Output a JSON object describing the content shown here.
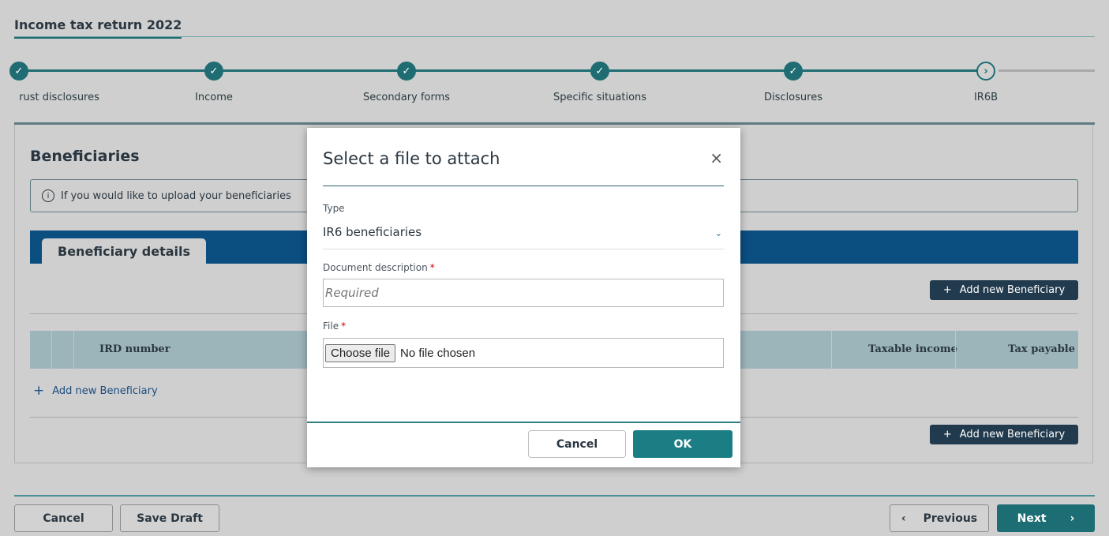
{
  "page": {
    "title": "Income tax return 2022"
  },
  "stepper": {
    "steps": [
      {
        "label": "rust disclosures",
        "status": "complete"
      },
      {
        "label": "Income",
        "status": "complete"
      },
      {
        "label": "Secondary forms",
        "status": "complete"
      },
      {
        "label": "Specific situations",
        "status": "complete"
      },
      {
        "label": "Disclosures",
        "status": "complete"
      },
      {
        "label": "IR6B",
        "status": "current"
      }
    ],
    "check_glyph": "✓",
    "current_glyph": "›"
  },
  "section": {
    "title": "Beneficiaries",
    "info_text": "If you would like to upload your beneficiaries",
    "tab_label": "Beneficiary details",
    "add_button_label": "Add new Beneficiary",
    "add_link_label": "Add new Beneficiary",
    "columns": [
      "IRD number",
      "Taxable income",
      "Tax payable"
    ]
  },
  "footer": {
    "cancel_label": "Cancel",
    "save_draft_label": "Save Draft",
    "previous_label": "Previous",
    "next_label": "Next"
  },
  "modal": {
    "title": "Select a file to attach",
    "close_glyph": "×",
    "type_label": "Type",
    "type_value": "IR6 beneficiaries",
    "description_label": "Document description",
    "description_placeholder": "Required",
    "file_label": "File",
    "file_button_label": "Choose file",
    "file_status": "No file chosen",
    "cancel_label": "Cancel",
    "ok_label": "OK"
  },
  "colors": {
    "accent": "#1f6c73",
    "banner": "#0b4e80",
    "dark_button": "#213a4d"
  }
}
